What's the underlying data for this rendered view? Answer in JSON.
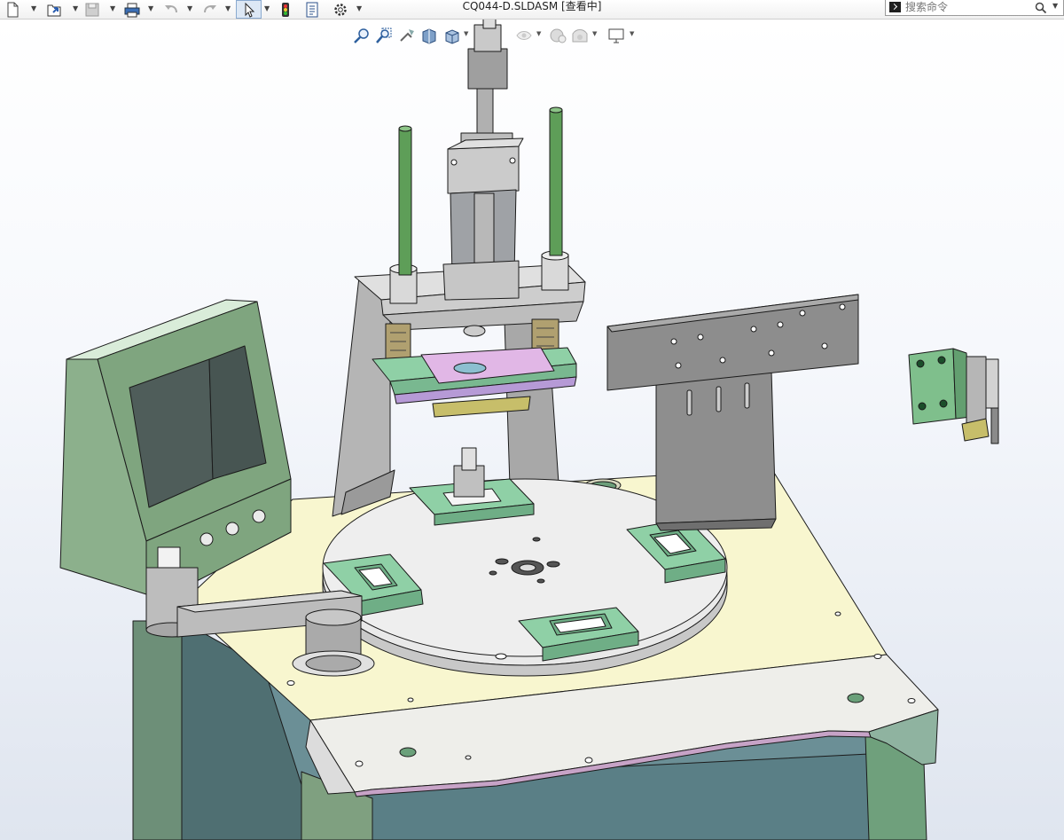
{
  "window": {
    "title": "CQ044-D.SLDASM [查看中]"
  },
  "toolbar": {
    "items": [
      "new-icon",
      "open-icon",
      "save-icon",
      "print-icon",
      "undo-icon",
      "redo-icon",
      "select-icon",
      "rebuild-icon",
      "file-properties-icon",
      "options-icon"
    ]
  },
  "search": {
    "placeholder": "搜索命令"
  },
  "view_toolbar": {
    "items": [
      "zoom-to-fit-icon",
      "zoom-to-area-icon",
      "previous-view-icon",
      "section-view-icon",
      "view-orientation-icon",
      "display-style-icon",
      "hide-show-items-icon",
      "edit-appearance-icon",
      "apply-scene-icon",
      "view-settings-icon"
    ]
  },
  "colors": {
    "frame_green": "#7fa57f",
    "fixture_green": "#8fd0a6",
    "table_top": "#f8f6cf",
    "steel": "#bdbdbd",
    "guide_rod": "#5e9e58",
    "plate_purple": "#b69ad6"
  }
}
